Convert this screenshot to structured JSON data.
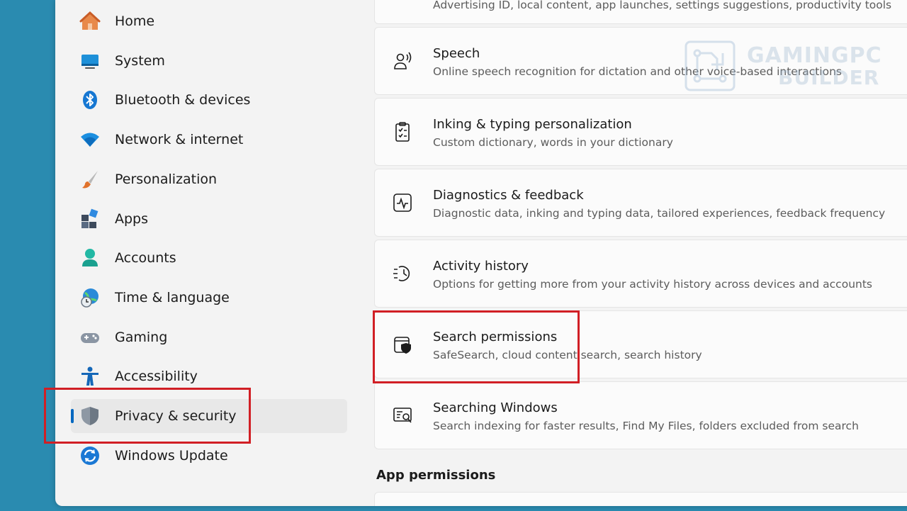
{
  "sidebar": {
    "items": [
      {
        "label": "Home",
        "icon": "home-icon"
      },
      {
        "label": "System",
        "icon": "system-icon"
      },
      {
        "label": "Bluetooth & devices",
        "icon": "bluetooth-icon"
      },
      {
        "label": "Network & internet",
        "icon": "wifi-icon"
      },
      {
        "label": "Personalization",
        "icon": "brush-icon"
      },
      {
        "label": "Apps",
        "icon": "apps-icon"
      },
      {
        "label": "Accounts",
        "icon": "person-icon"
      },
      {
        "label": "Time & language",
        "icon": "globe-clock-icon"
      },
      {
        "label": "Gaming",
        "icon": "gamepad-icon"
      },
      {
        "label": "Accessibility",
        "icon": "accessibility-icon"
      },
      {
        "label": "Privacy & security",
        "icon": "shield-icon",
        "selected": true
      },
      {
        "label": "Windows Update",
        "icon": "update-icon"
      }
    ]
  },
  "main": {
    "top_partial": {
      "subtitle": "Advertising ID, local content, app launches, settings suggestions, productivity tools"
    },
    "cards": [
      {
        "title": "Speech",
        "subtitle": "Online speech recognition for dictation and other voice-based interactions",
        "icon": "speech-icon"
      },
      {
        "title": "Inking & typing personalization",
        "subtitle": "Custom dictionary, words in your dictionary",
        "icon": "clipboard-list-icon"
      },
      {
        "title": "Diagnostics & feedback",
        "subtitle": "Diagnostic data, inking and typing data, tailored experiences, feedback frequency",
        "icon": "pulse-icon"
      },
      {
        "title": "Activity history",
        "subtitle": "Options for getting more from your activity history across devices and accounts",
        "icon": "history-icon"
      },
      {
        "title": "Search permissions",
        "subtitle": "SafeSearch, cloud content search, search history",
        "icon": "search-shield-icon"
      },
      {
        "title": "Searching Windows",
        "subtitle": "Search indexing for faster results, Find My Files, folders excluded from search",
        "icon": "search-window-icon"
      }
    ],
    "section_title": "App permissions"
  },
  "watermark": {
    "line1": "GAMINGPC",
    "line2": "BUILDER"
  },
  "colors": {
    "accent": "#0067c0",
    "highlight": "#d11f25",
    "desktop": "#2a8bb0"
  }
}
